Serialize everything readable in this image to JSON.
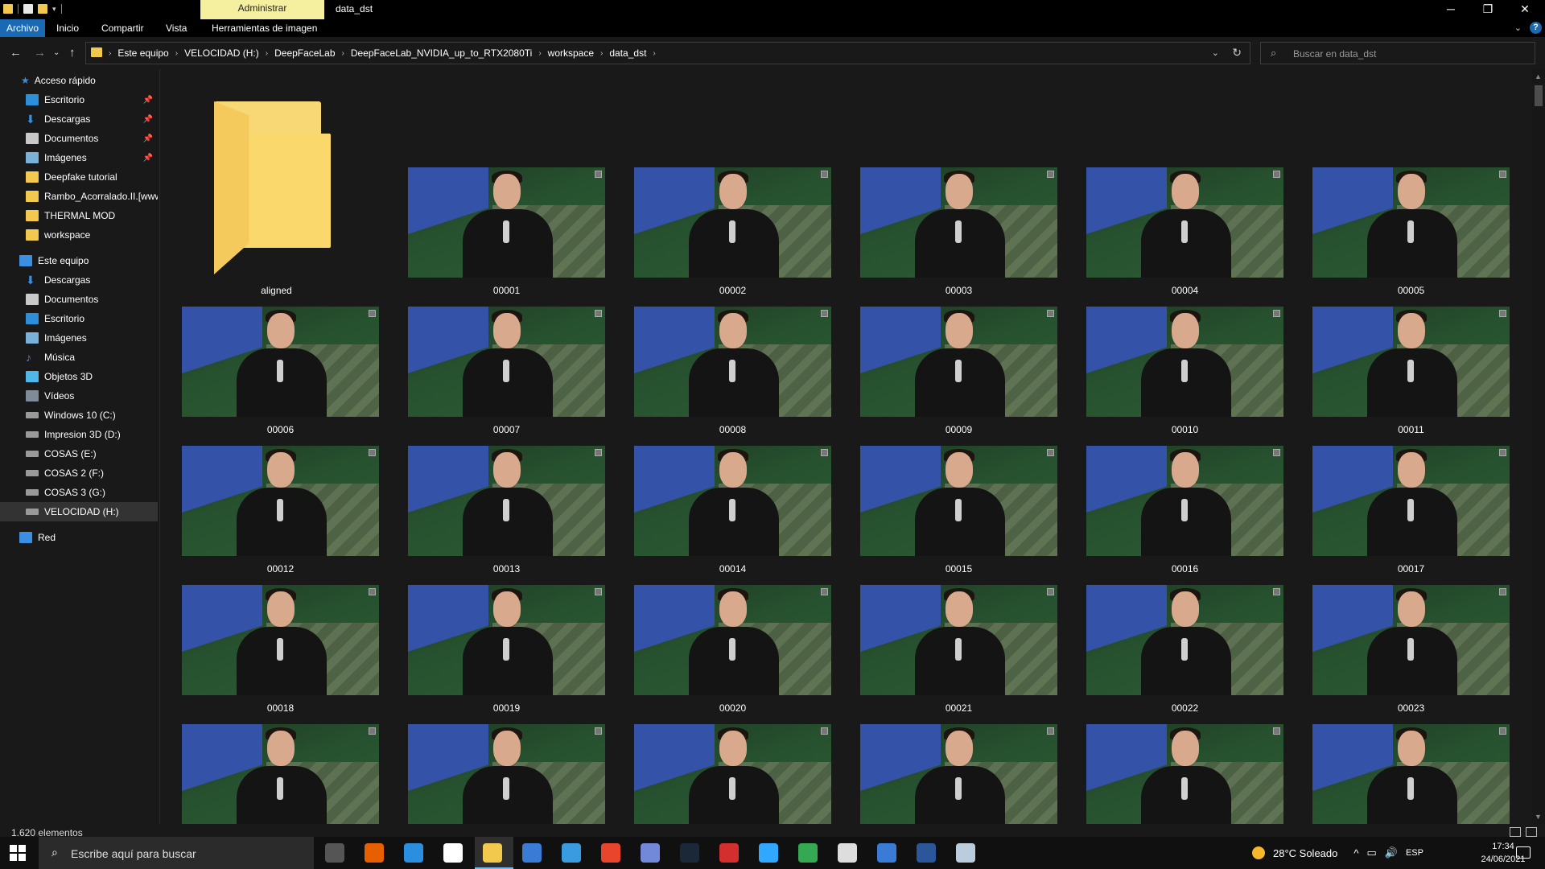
{
  "window": {
    "title": "data_dst",
    "context_tab": "Administrar",
    "controls": [
      "minimize",
      "restore",
      "close"
    ]
  },
  "ribbon": {
    "tabs": [
      {
        "label": "Archivo",
        "active": true
      },
      {
        "label": "Inicio"
      },
      {
        "label": "Compartir"
      },
      {
        "label": "Vista"
      },
      {
        "label": "Herramientas de imagen"
      }
    ]
  },
  "address": {
    "crumbs": [
      "Este equipo",
      "VELOCIDAD (H:)",
      "DeepFaceLab",
      "DeepFaceLab_NVIDIA_up_to_RTX2080Ti",
      "workspace",
      "data_dst"
    ],
    "search_placeholder": "Buscar en data_dst"
  },
  "sidebar": {
    "quick_access": "Acceso rápido",
    "quick_items": [
      {
        "label": "Escritorio",
        "icon": "desktop-icon",
        "pinned": true
      },
      {
        "label": "Descargas",
        "icon": "download-icon",
        "pinned": true
      },
      {
        "label": "Documentos",
        "icon": "document-icon",
        "pinned": true
      },
      {
        "label": "Imágenes",
        "icon": "pictures-icon",
        "pinned": true
      },
      {
        "label": "Deepfake tutorial",
        "icon": "folder-icon"
      },
      {
        "label": "Rambo_Acorralado.II.[www",
        "icon": "folder-icon"
      },
      {
        "label": "THERMAL MOD",
        "icon": "folder-icon"
      },
      {
        "label": "workspace",
        "icon": "folder-icon"
      }
    ],
    "this_pc": "Este equipo",
    "pc_items": [
      {
        "label": "Descargas",
        "icon": "download-icon"
      },
      {
        "label": "Documentos",
        "icon": "document-icon"
      },
      {
        "label": "Escritorio",
        "icon": "desktop-icon"
      },
      {
        "label": "Imágenes",
        "icon": "pictures-icon"
      },
      {
        "label": "Música",
        "icon": "music-icon"
      },
      {
        "label": "Objetos 3D",
        "icon": "objects3d-icon"
      },
      {
        "label": "Vídeos",
        "icon": "videos-icon"
      },
      {
        "label": "Windows 10 (C:)",
        "icon": "drive-icon"
      },
      {
        "label": "Impresion 3D (D:)",
        "icon": "drive-icon"
      },
      {
        "label": "COSAS (E:)",
        "icon": "drive-icon"
      },
      {
        "label": "COSAS 2 (F:)",
        "icon": "drive-icon"
      },
      {
        "label": "COSAS 3 (G:)",
        "icon": "drive-icon"
      },
      {
        "label": "VELOCIDAD (H:)",
        "icon": "drive-icon",
        "selected": true
      }
    ],
    "network": "Red"
  },
  "content": {
    "folder": "aligned",
    "files": [
      "00001",
      "00002",
      "00003",
      "00004",
      "00005",
      "00006",
      "00007",
      "00008",
      "00009",
      "00010",
      "00011",
      "00012",
      "00013",
      "00014",
      "00015",
      "00016",
      "00017",
      "00018",
      "00019",
      "00020",
      "00021",
      "00022",
      "00023",
      "",
      "",
      "",
      "",
      "",
      ""
    ]
  },
  "status": {
    "count": "1.620 elementos"
  },
  "taskbar": {
    "search_placeholder": "Escribe aquí para buscar",
    "apps": [
      "task-view-icon",
      "firefox-icon",
      "edge-icon",
      "media-icon",
      "file-explorer-icon",
      "store-icon",
      "mail-icon",
      "brave-icon",
      "discord-icon",
      "steam-icon",
      "app-icon",
      "photoshop-icon",
      "chrome-icon",
      "camera-icon",
      "calculator-icon",
      "word-icon",
      "tool-icon"
    ],
    "weather": "28°C  Soleado",
    "lang": "ESP",
    "time": "17:34",
    "date": "24/06/2021"
  },
  "colors": {
    "accent": "#1a69b5",
    "folder": "#f4ca5c",
    "background": "#191919",
    "context_tab": "#f5f0a0"
  }
}
